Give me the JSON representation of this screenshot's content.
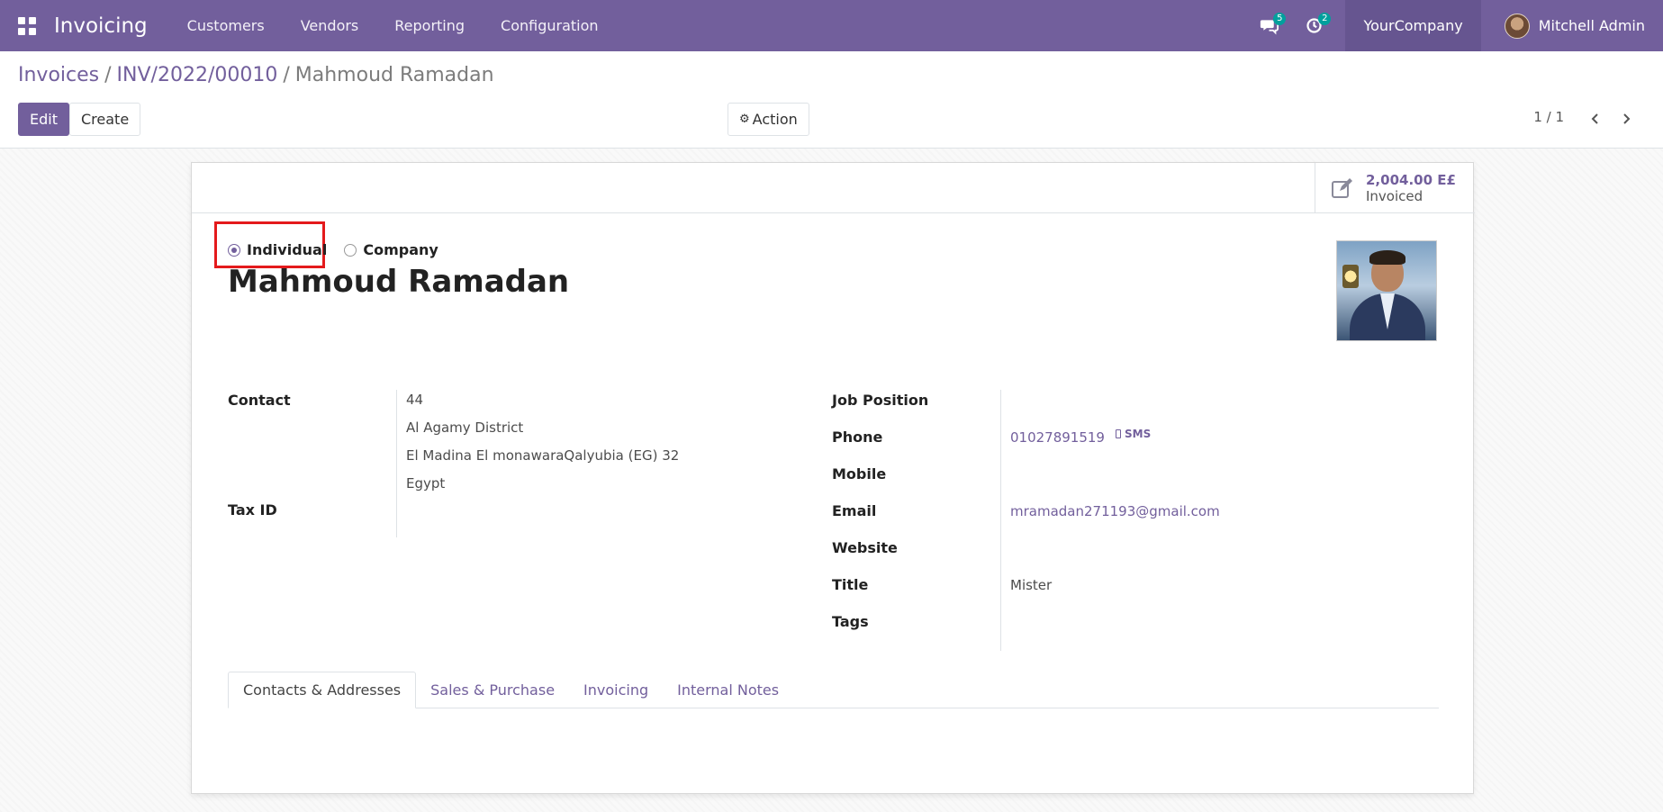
{
  "navbar": {
    "app_name": "Invoicing",
    "menu": [
      "Customers",
      "Vendors",
      "Reporting",
      "Configuration"
    ],
    "messages_badge": "5",
    "activities_badge": "2",
    "company": "YourCompany",
    "user": "Mitchell Admin"
  },
  "control_panel": {
    "breadcrumb": [
      "Invoices",
      "INV/2022/00010",
      "Mahmoud Ramadan"
    ],
    "breadcrumb_sep": "/",
    "edit_label": "Edit",
    "create_label": "Create",
    "action_label": "Action",
    "pager": "1 / 1"
  },
  "stat_button": {
    "value": "2,004.00 E£",
    "label": "Invoiced"
  },
  "company_type": {
    "options": [
      "Individual",
      "Company"
    ],
    "selected": "Individual"
  },
  "partner": {
    "name": "Mahmoud Ramadan"
  },
  "left_fields": {
    "contact_label": "Contact",
    "address_lines": [
      "44",
      "Al Agamy District",
      "El Madina El monawaraQalyubia (EG)  32",
      "Egypt"
    ],
    "tax_id_label": "Tax ID"
  },
  "right_fields": {
    "job_position_label": "Job Position",
    "phone_label": "Phone",
    "phone_value": "01027891519",
    "sms_label": "SMS",
    "mobile_label": "Mobile",
    "email_label": "Email",
    "email_value": "mramadan271193@gmail.com",
    "website_label": "Website",
    "title_label": "Title",
    "title_value": "Mister",
    "tags_label": "Tags"
  },
  "tabs": [
    "Contacts & Addresses",
    "Sales & Purchase",
    "Invoicing",
    "Internal Notes"
  ],
  "colors": {
    "brand": "#725f9c",
    "badge": "#00a09d",
    "highlight": "#e41a1c"
  }
}
